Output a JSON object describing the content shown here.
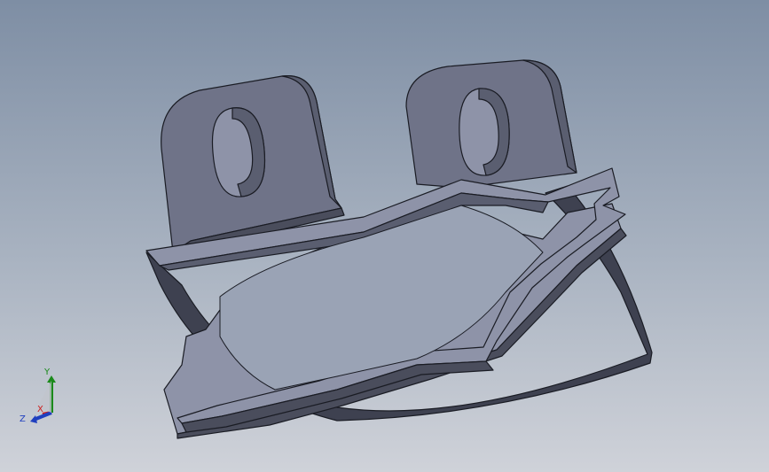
{
  "viewport": {
    "background_top": "#7e8ea4",
    "background_bottom": "#cfd2d9"
  },
  "part": {
    "face_color": "#8e93a8",
    "top_face_color": "#757990",
    "dark_face_color": "#3e4150",
    "edge_color": "#1a1c24"
  },
  "triad": {
    "x_label": "X",
    "y_label": "Y",
    "z_label": "Z",
    "x_color": "#cc1f1f",
    "y_color": "#1b8a1b",
    "z_color": "#1f3fbf"
  }
}
